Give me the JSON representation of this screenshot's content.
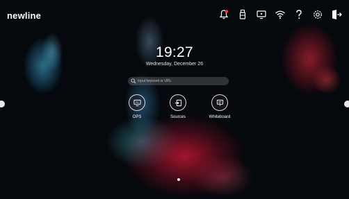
{
  "brand": {
    "logo_text": "newline"
  },
  "status_icons": [
    "notification-bell-icon",
    "usb-icon",
    "screen-cast-icon",
    "wifi-icon",
    "help-icon",
    "settings-icon",
    "sign-out-icon"
  ],
  "clock": {
    "time": "19:27",
    "date": "Wednesday, December 26"
  },
  "search": {
    "placeholder": "Input keyword or URL"
  },
  "apps": [
    {
      "label": "OPS",
      "icon": "ops-pc-icon"
    },
    {
      "label": "Sources",
      "icon": "source-input-icon"
    },
    {
      "label": "Whiteboard",
      "icon": "whiteboard-icon"
    }
  ],
  "colors": {
    "notification_dot": "#ff2d2d",
    "accent_red": "#d8193a",
    "accent_blue": "#4cc0e6"
  }
}
